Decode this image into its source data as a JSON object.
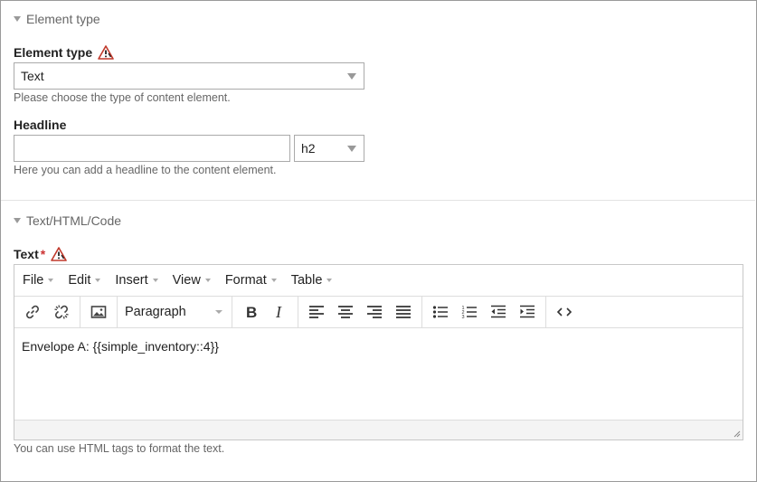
{
  "section1": {
    "legend": "Element type",
    "element_type": {
      "label": "Element type",
      "value": "Text",
      "help": "Please choose the type of content element."
    },
    "headline": {
      "label": "Headline",
      "value": "",
      "level": "h2",
      "help": "Here you can add a headline to the content element."
    }
  },
  "section2": {
    "legend": "Text/HTML/Code",
    "text": {
      "label": "Text",
      "required_mark": "*",
      "help": "You can use HTML tags to format the text."
    }
  },
  "editor": {
    "menu": [
      "File",
      "Edit",
      "Insert",
      "View",
      "Format",
      "Table"
    ],
    "block_format": "Paragraph",
    "content": "Envelope A: {{simple_inventory::4}}",
    "icons": {
      "link": "link-icon",
      "unlink": "unlink-icon",
      "image": "image-icon",
      "bold": "bold-icon",
      "italic": "italic-icon",
      "align_left": "align-left-icon",
      "align_center": "align-center-icon",
      "align_right": "align-right-icon",
      "align_justify": "align-justify-icon",
      "bullet_list": "bullet-list-icon",
      "numbered_list": "numbered-list-icon",
      "outdent": "outdent-icon",
      "indent": "indent-icon",
      "source_code": "source-code-icon"
    }
  },
  "colors": {
    "warning_red": "#c0392b",
    "required_red": "#cc3333",
    "border": "#aaaaaa",
    "help_text": "#666666"
  }
}
